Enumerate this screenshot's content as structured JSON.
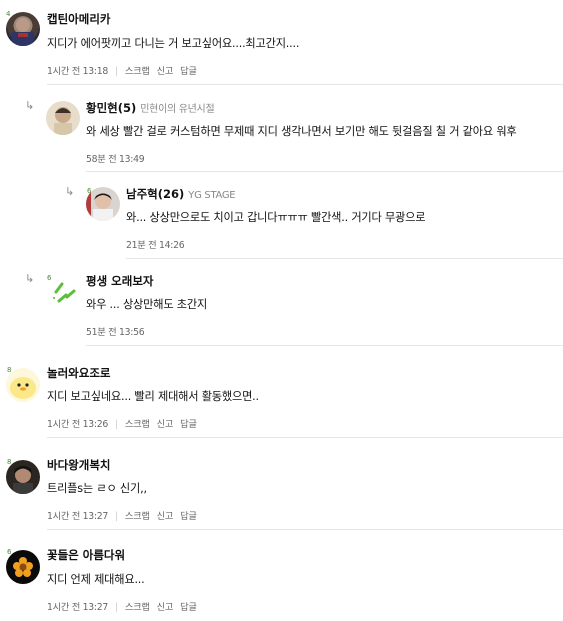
{
  "comments": [
    {
      "nick": "캡틴아메리카",
      "badge": "",
      "level": "4",
      "text": "지디가 에어팟끼고 다니는 거 보고싶어요....최고간지....",
      "time": "1시간 전 13:18",
      "actions": [
        "스크랩",
        "신고",
        "답글"
      ]
    },
    {
      "nick": "황민현(5)",
      "badge": "민현이의 유년시절",
      "level": "",
      "text": "와 세상 빨간 걸로 커스텀하면 무제때 지디 생각나면서 보기만 해도 뒷걸음질 칠 거 같아요 워후",
      "time": "58분 전 13:49",
      "actions": []
    },
    {
      "nick": "남주혁(26)",
      "badge": "YG STAGE",
      "level": "6",
      "text": "와... 상상만으로도 치이고 갑니다ㅠㅠㅠ 빨간색.. 거기다 무광으로",
      "time": "21분 전 14:26",
      "actions": []
    },
    {
      "nick": "평생 오래보자",
      "badge": "",
      "level": "6",
      "text": "와우 ... 상상만해도 초간지",
      "time": "51분 전 13:56",
      "actions": []
    },
    {
      "nick": "놀러와요조로",
      "badge": "",
      "level": "8",
      "text": "지디 보고싶네요... 빨리 제대해서 활동했으면..",
      "time": "1시간 전 13:26",
      "actions": [
        "스크랩",
        "신고",
        "답글"
      ]
    },
    {
      "nick": "바다왕개복치",
      "badge": "",
      "level": "8",
      "text": "트리플s는 ㄹㅇ 신기,,",
      "time": "1시간 전 13:27",
      "actions": [
        "스크랩",
        "신고",
        "답글"
      ]
    },
    {
      "nick": "꽃들은 아름다워",
      "badge": "",
      "level": "6",
      "text": "지디 언제 제대해요...",
      "time": "1시간 전 13:27",
      "actions": [
        "스크랩",
        "신고",
        "답글"
      ]
    }
  ],
  "reply_icon": "reply-arrow-icon",
  "colors": {
    "divider": "#e6e6e6",
    "meta": "#666666",
    "level_badge": "#4a8a3a"
  }
}
